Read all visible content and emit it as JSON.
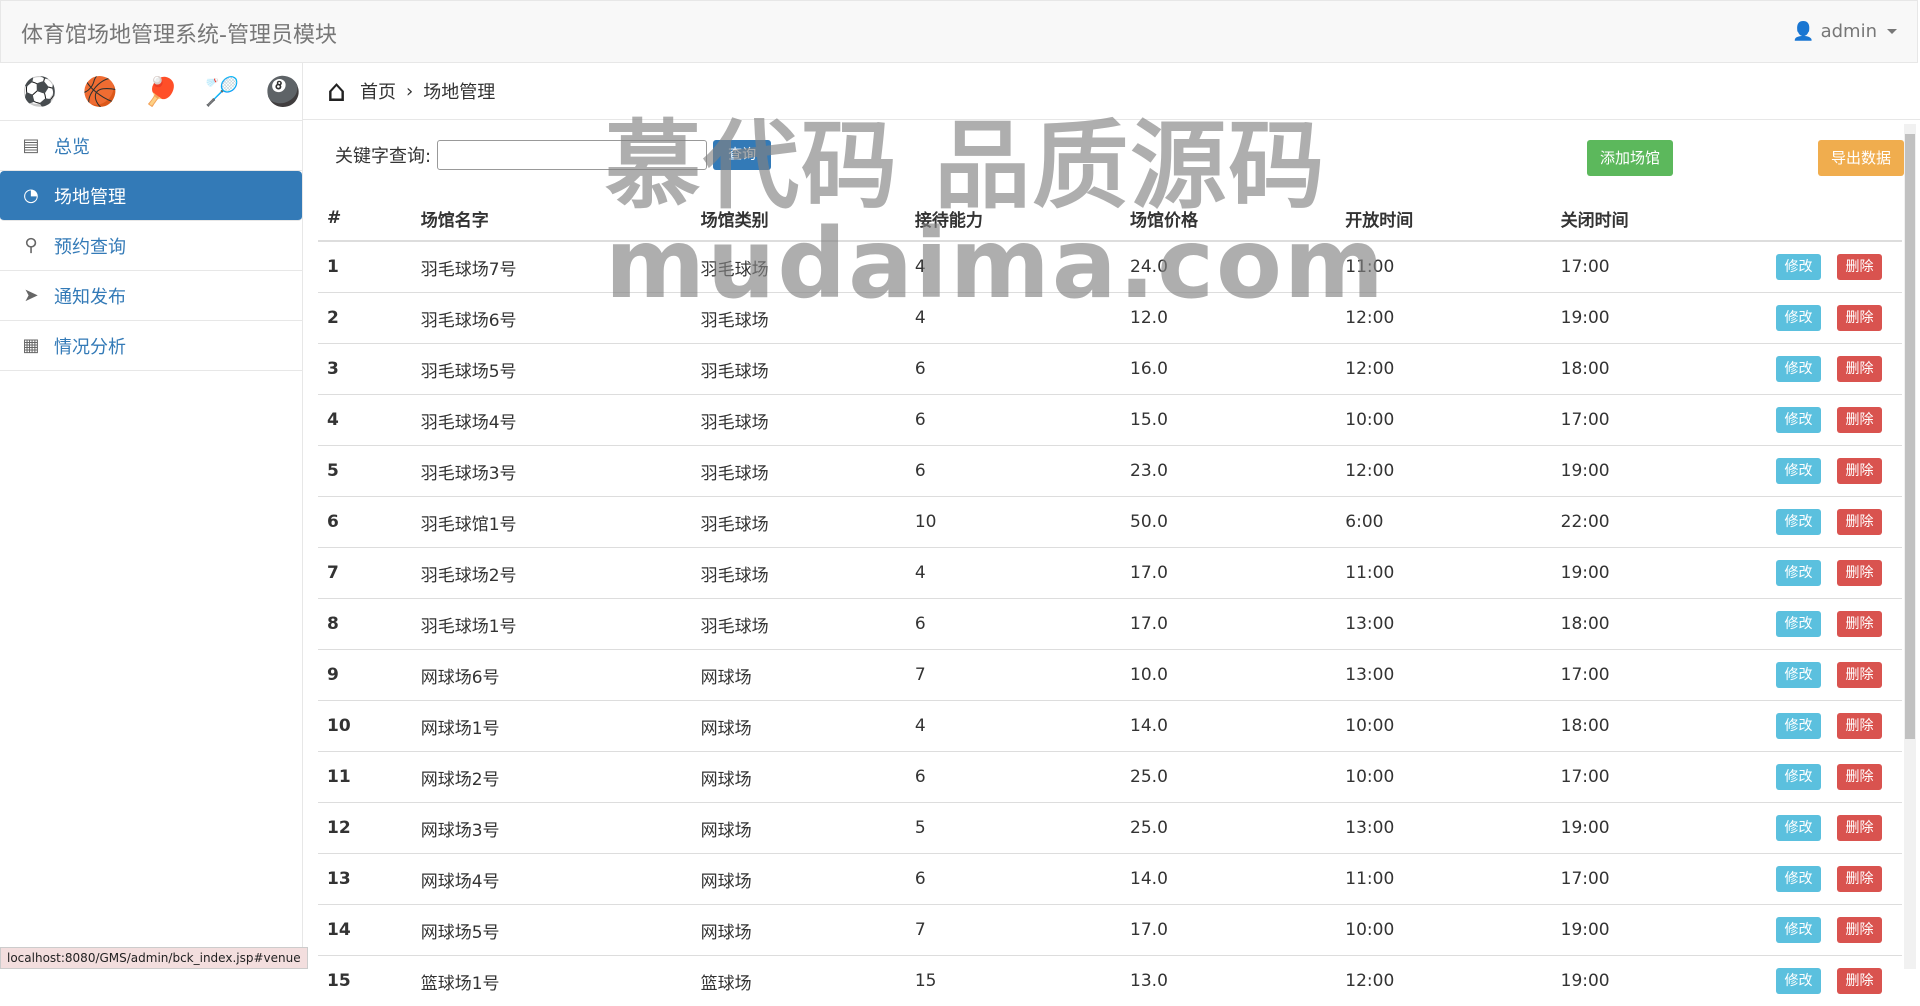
{
  "app": {
    "title": "体育馆场地管理系统-管理员模块",
    "user": "admin"
  },
  "sports": [
    "⚽",
    "🏀",
    "🏓",
    "🏸",
    "🎱"
  ],
  "sidebar": {
    "items": [
      {
        "label": "总览",
        "icon": "report-icon"
      },
      {
        "label": "场地管理",
        "icon": "dashboard-icon"
      },
      {
        "label": "预约查询",
        "icon": "search-icon"
      },
      {
        "label": "通知发布",
        "icon": "send-icon"
      },
      {
        "label": "情况分析",
        "icon": "analysis-icon"
      }
    ]
  },
  "breadcrumb": {
    "home": "首页",
    "current": "场地管理"
  },
  "query": {
    "label": "关键字查询:",
    "button": "查询",
    "value": ""
  },
  "actions": {
    "add": "添加场馆",
    "export": "导出数据",
    "edit": "修改",
    "delete": "删除"
  },
  "table": {
    "headers": [
      "#",
      "场馆名字",
      "场馆类别",
      "接待能力",
      "场馆价格",
      "开放时间",
      "关闭时间"
    ],
    "rows": [
      [
        "1",
        "羽毛球场7号",
        "羽毛球场",
        "4",
        "24.0",
        "11:00",
        "17:00"
      ],
      [
        "2",
        "羽毛球场6号",
        "羽毛球场",
        "4",
        "12.0",
        "12:00",
        "19:00"
      ],
      [
        "3",
        "羽毛球场5号",
        "羽毛球场",
        "6",
        "16.0",
        "12:00",
        "18:00"
      ],
      [
        "4",
        "羽毛球场4号",
        "羽毛球场",
        "6",
        "15.0",
        "10:00",
        "17:00"
      ],
      [
        "5",
        "羽毛球场3号",
        "羽毛球场",
        "6",
        "23.0",
        "12:00",
        "19:00"
      ],
      [
        "6",
        "羽毛球馆1号",
        "羽毛球场",
        "10",
        "50.0",
        "6:00",
        "22:00"
      ],
      [
        "7",
        "羽毛球场2号",
        "羽毛球场",
        "4",
        "17.0",
        "11:00",
        "19:00"
      ],
      [
        "8",
        "羽毛球场1号",
        "羽毛球场",
        "6",
        "17.0",
        "13:00",
        "18:00"
      ],
      [
        "9",
        "网球场6号",
        "网球场",
        "7",
        "10.0",
        "13:00",
        "17:00"
      ],
      [
        "10",
        "网球场1号",
        "网球场",
        "4",
        "14.0",
        "10:00",
        "18:00"
      ],
      [
        "11",
        "网球场2号",
        "网球场",
        "6",
        "25.0",
        "10:00",
        "17:00"
      ],
      [
        "12",
        "网球场3号",
        "网球场",
        "5",
        "25.0",
        "13:00",
        "19:00"
      ],
      [
        "13",
        "网球场4号",
        "网球场",
        "6",
        "14.0",
        "11:00",
        "17:00"
      ],
      [
        "14",
        "网球场5号",
        "网球场",
        "7",
        "17.0",
        "10:00",
        "19:00"
      ],
      [
        "15",
        "篮球场1号",
        "篮球场",
        "15",
        "13.0",
        "12:00",
        "19:00"
      ]
    ]
  },
  "watermark": {
    "line1": "慕代码 品质源码",
    "line2": "mudaima.com"
  },
  "statusbar": "localhost:8080/GMS/admin/bck_index.jsp#venue"
}
